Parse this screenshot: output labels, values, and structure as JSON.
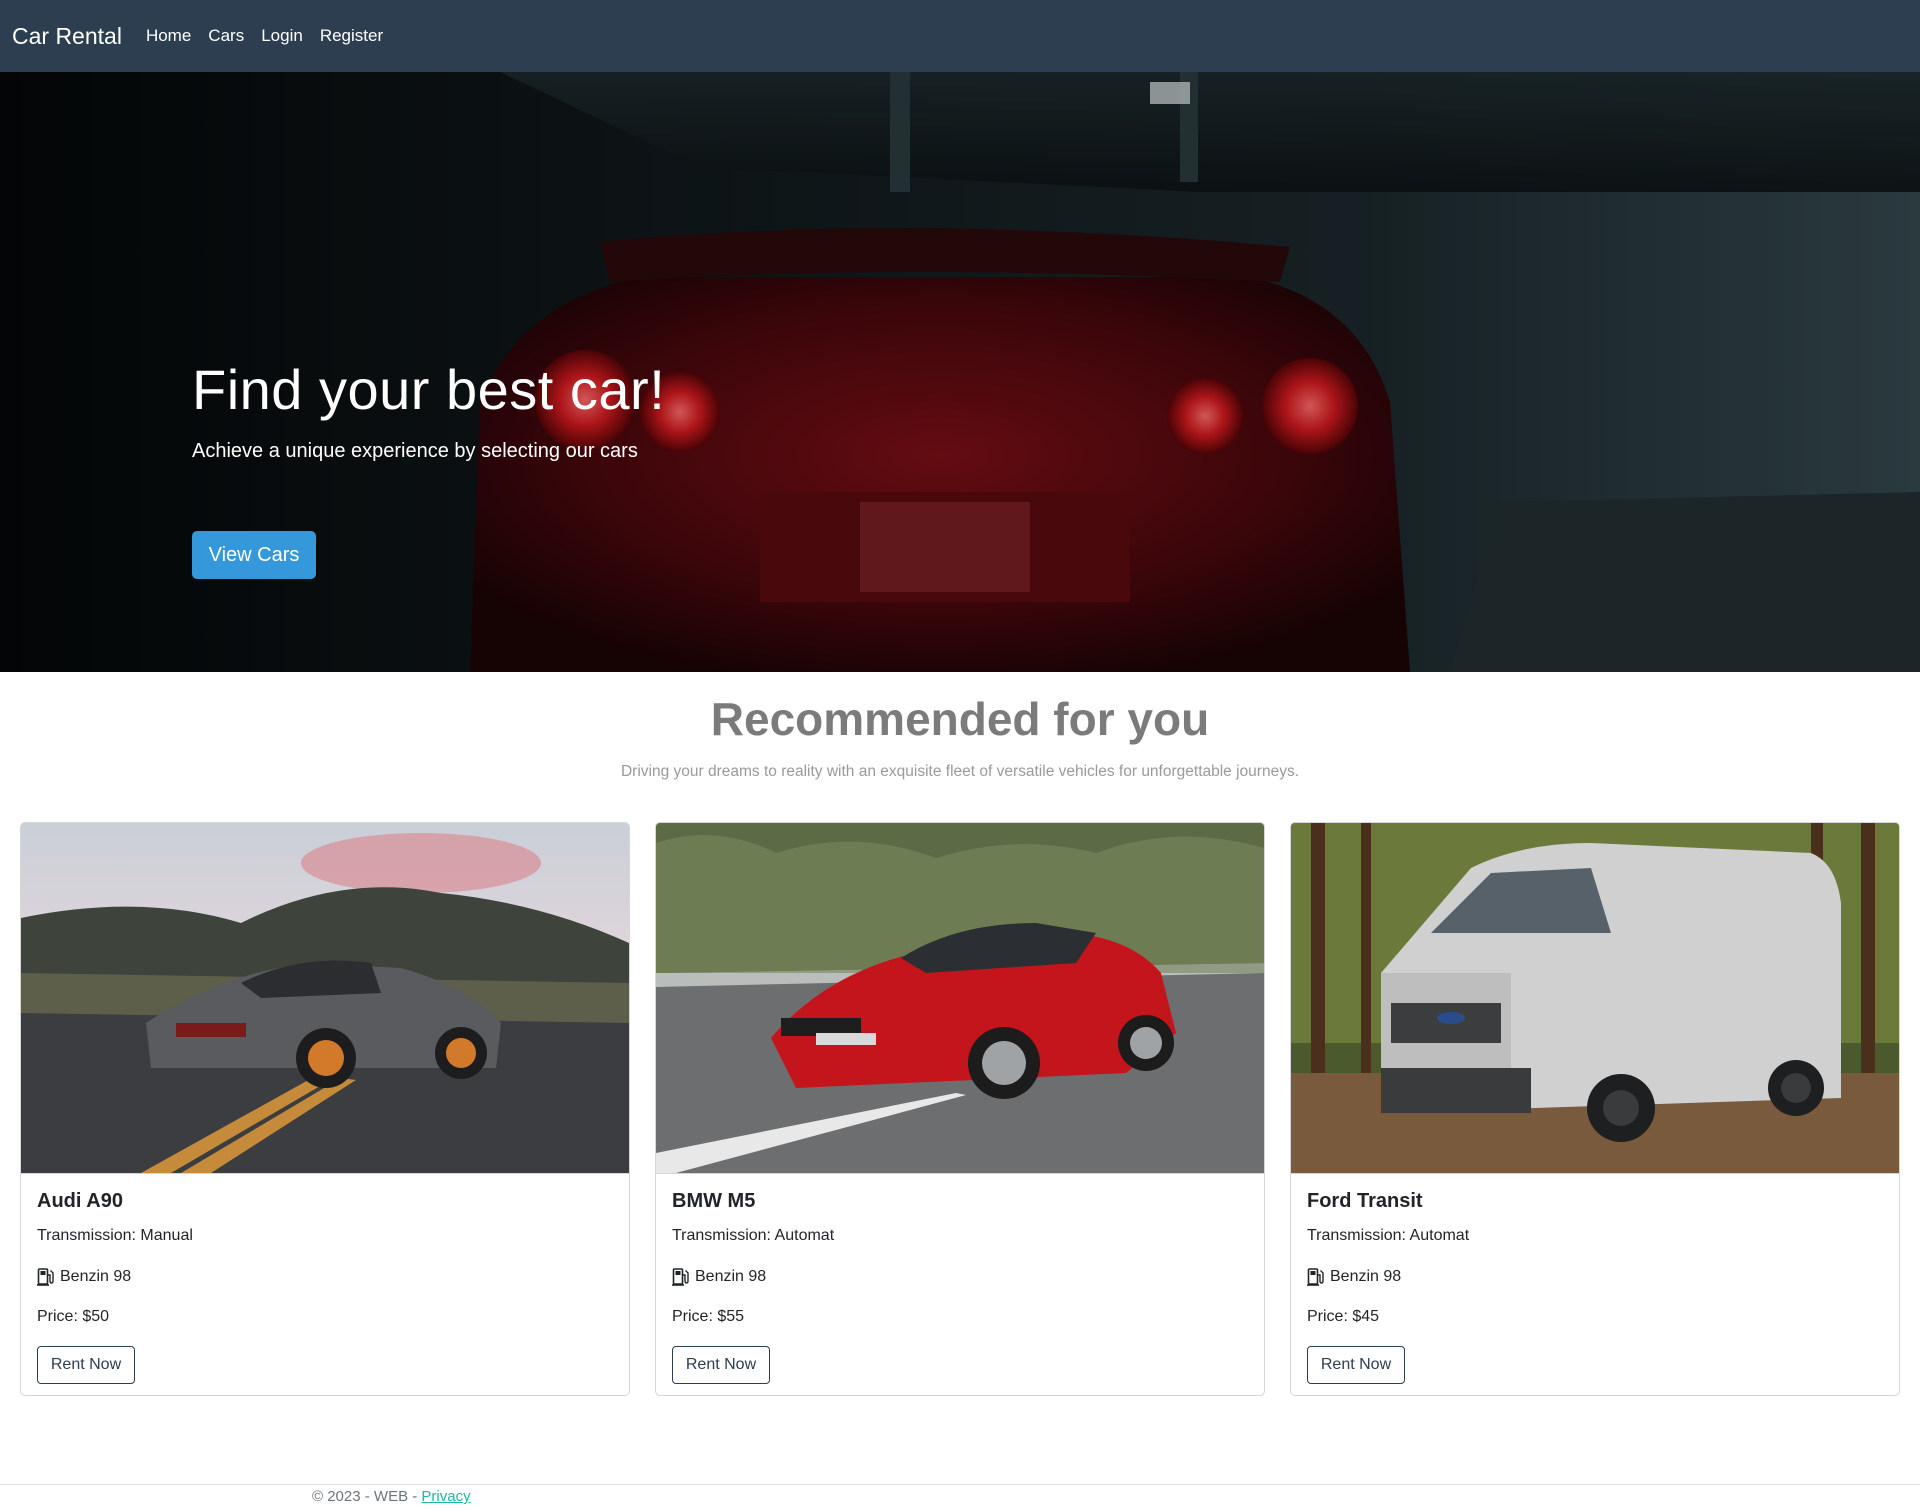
{
  "navbar": {
    "brand": "Car Rental",
    "links": [
      "Home",
      "Cars",
      "Login",
      "Register"
    ]
  },
  "hero": {
    "title": "Find your best car!",
    "subtitle": "Achieve a unique experience by selecting our cars",
    "button_label": "View Cars"
  },
  "recommended": {
    "title": "Recommended for you",
    "subtitle": "Driving your dreams to reality with an exquisite fleet of versatile vehicles for unforgettable journeys."
  },
  "cars": [
    {
      "name": "Audi A90",
      "transmission": "Transmission: Manual",
      "fuel": "Benzin 98",
      "price": "Price: $50",
      "button_label": "Rent Now"
    },
    {
      "name": "BMW M5",
      "transmission": "Transmission: Automat",
      "fuel": "Benzin 98",
      "price": "Price: $55",
      "button_label": "Rent Now"
    },
    {
      "name": "Ford Transit",
      "transmission": "Transmission: Automat",
      "fuel": "Benzin 98",
      "price": "Price: $45",
      "button_label": "Rent Now"
    }
  ],
  "footer": {
    "text": "© 2023 - WEB - ",
    "link": "Privacy"
  },
  "colors": {
    "navbar_bg": "#2c3e50",
    "primary_button": "#3498db",
    "footer_link": "#1abc9c"
  }
}
